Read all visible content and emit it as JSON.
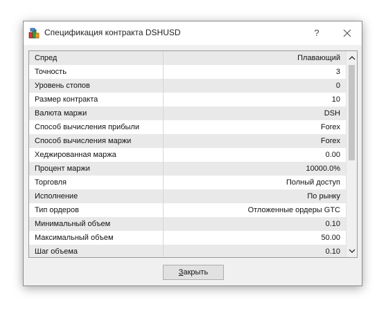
{
  "window": {
    "title": "Спецификация контракта DSHUSD",
    "help_symbol": "?",
    "icons": {
      "app": "chart-bars-icon",
      "close": "close-icon",
      "scroll_up": "chevron-up-icon",
      "scroll_down": "chevron-down-icon"
    }
  },
  "specs": {
    "rows": [
      {
        "name": "Спред",
        "value": "Плавающий"
      },
      {
        "name": "Точность",
        "value": "3"
      },
      {
        "name": "Уровень стопов",
        "value": "0"
      },
      {
        "name": "Размер контракта",
        "value": "10"
      },
      {
        "name": "Валюта маржи",
        "value": "DSH"
      },
      {
        "name": "Способ вычисления прибыли",
        "value": "Forex"
      },
      {
        "name": "Способ вычисления маржи",
        "value": "Forex"
      },
      {
        "name": "Хеджированная маржа",
        "value": "0.00"
      },
      {
        "name": "Процент маржи",
        "value": "10000.0%"
      },
      {
        "name": "Торговля",
        "value": "Полный доступ"
      },
      {
        "name": "Исполнение",
        "value": "По рынку"
      },
      {
        "name": "Тип ордеров",
        "value": "Отложенные ордеры GTC"
      },
      {
        "name": "Минимальный объем",
        "value": "0.10"
      },
      {
        "name": "Максимальный объем",
        "value": "50.00"
      },
      {
        "name": "Шаг объема",
        "value": "0.10"
      }
    ]
  },
  "footer": {
    "close_mnemonic": "З",
    "close_rest": "акрыть"
  },
  "colors": {
    "row_alt": "#e9e9e9",
    "button": "#e1e1e1",
    "scroll_thumb": "#c4c4c4"
  }
}
